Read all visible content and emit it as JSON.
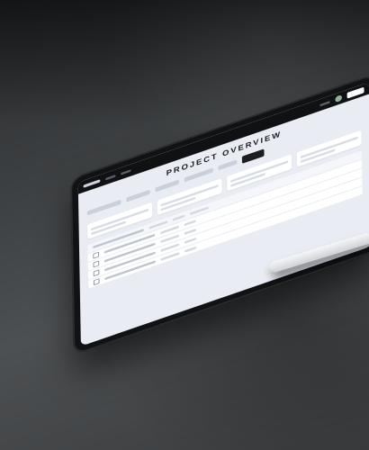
{
  "tablet": {
    "app": {
      "page_title": "PROJECT OVERVIEW"
    }
  },
  "colors": {
    "surface": "#4a4d4f",
    "tablet_bezel": "#111214",
    "screen_bg": "#e9edf3",
    "accent": "#8fb39a"
  },
  "icons": [
    "avatar-icon",
    "checkbox-icon"
  ]
}
